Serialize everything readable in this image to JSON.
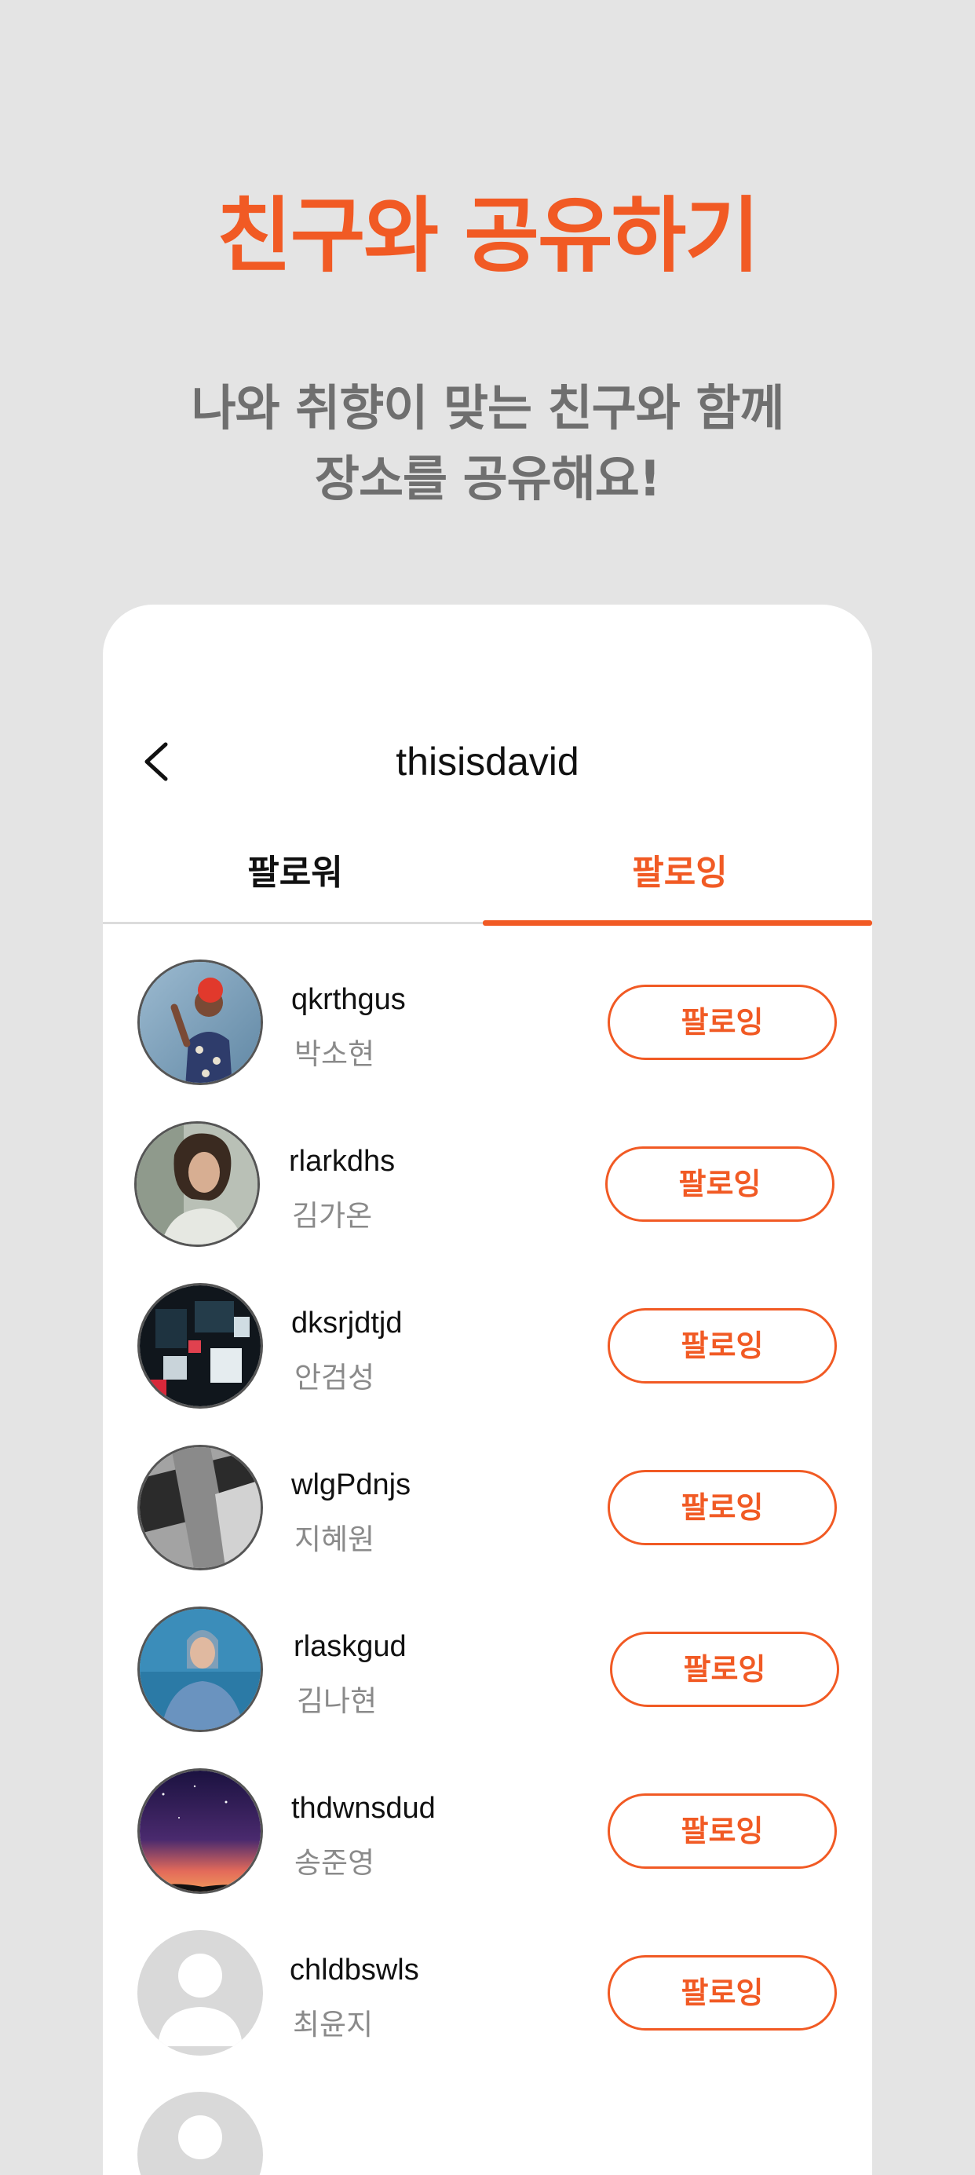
{
  "colors": {
    "accent": "#f15a24",
    "background": "#e4e4e4",
    "subtext": "#6f6f6f"
  },
  "hero": {
    "title": "친구와 공유하기",
    "subtitle_line1": "나와 취향이 맞는 친구와 함께",
    "subtitle_line2": "장소를 공유해요!"
  },
  "header": {
    "back_icon": "chevron-left-icon",
    "title": "thisisdavid"
  },
  "tabs": [
    {
      "label": "팔로워",
      "active": false
    },
    {
      "label": "팔로잉",
      "active": true
    }
  ],
  "following": [
    {
      "username": "qkrthgus",
      "name": "박소현",
      "button": "팔로잉",
      "avatar": "photo-red-hair"
    },
    {
      "username": "rlarkdhs",
      "name": "김가온",
      "button": "팔로잉",
      "avatar": "photo-curly-hair"
    },
    {
      "username": "dksrjdtjd",
      "name": "안검성",
      "button": "팔로잉",
      "avatar": "photo-city-night"
    },
    {
      "username": "wlgPdnjs",
      "name": "지혜원",
      "button": "팔로잉",
      "avatar": "photo-grey-abstract"
    },
    {
      "username": "rlaskgud",
      "name": "김나현",
      "button": "팔로잉",
      "avatar": "photo-denim-jacket"
    },
    {
      "username": "thdwnsdud",
      "name": "송준영",
      "button": "팔로잉",
      "avatar": "photo-night-sky"
    },
    {
      "username": "chldbswls",
      "name": "최윤지",
      "button": "팔로잉",
      "avatar": "default-avatar"
    }
  ]
}
